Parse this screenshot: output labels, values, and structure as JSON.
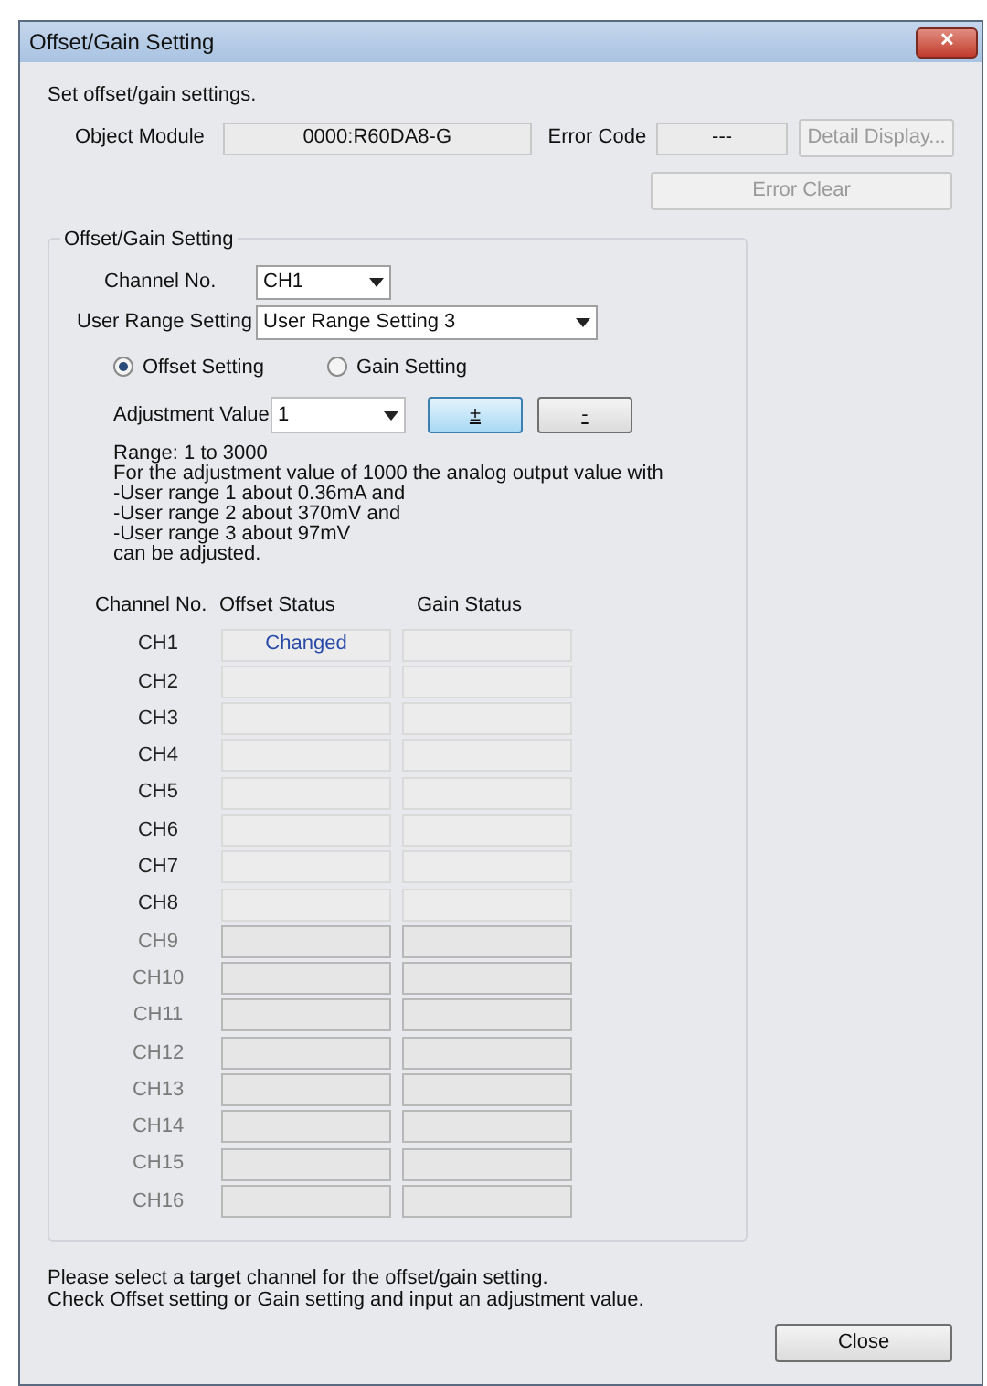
{
  "window": {
    "title": "Offset/Gain Setting",
    "close": "✕"
  },
  "intro": "Set offset/gain settings.",
  "module": {
    "label": "Object Module",
    "value": "0000:R60DA8-G"
  },
  "error": {
    "label": "Error Code",
    "value": "---",
    "detail_button": {
      "label": "Detail Display...",
      "disabled": true
    },
    "clear_button": {
      "label": "Error Clear",
      "disabled": true
    }
  },
  "group": {
    "title": "Offset/Gain Setting",
    "channel": {
      "label": "Channel No.",
      "value": "CH1"
    },
    "user_range": {
      "label": "User Range Setting",
      "value": "User Range Setting 3"
    },
    "radios": [
      {
        "label": "Offset Setting",
        "selected": true
      },
      {
        "label": "Gain Setting",
        "selected": false
      }
    ],
    "adjustment": {
      "label": "Adjustment Value",
      "value": "1",
      "plus_button": "±",
      "minus_button": "-"
    },
    "help": [
      "Range: 1 to 3000",
      "For the adjustment value of 1000 the analog output value with",
      "-User range 1 about 0.36mA and",
      "-User range 2 about 370mV and",
      "-User range 3 about 97mV",
      "can be adjusted."
    ],
    "table": {
      "columns": [
        "Channel No.",
        "Offset Status",
        "Gain Status"
      ],
      "rows": [
        {
          "channel": "CH1",
          "offset": "Changed",
          "enabled": true
        },
        {
          "channel": "CH2",
          "enabled": true
        },
        {
          "channel": "CH3",
          "enabled": true
        },
        {
          "channel": "CH4",
          "enabled": true
        },
        {
          "channel": "CH5",
          "enabled": true
        },
        {
          "channel": "CH6",
          "enabled": true
        },
        {
          "channel": "CH7",
          "enabled": true
        },
        {
          "channel": "CH8",
          "enabled": true
        },
        {
          "channel": "CH9",
          "enabled": false
        },
        {
          "channel": "CH10",
          "enabled": false
        },
        {
          "channel": "CH11",
          "enabled": false
        },
        {
          "channel": "CH12",
          "enabled": false
        },
        {
          "channel": "CH13",
          "enabled": false
        },
        {
          "channel": "CH14",
          "enabled": false
        },
        {
          "channel": "CH15",
          "enabled": false
        },
        {
          "channel": "CH16",
          "enabled": false
        }
      ]
    }
  },
  "footer": [
    "Please select a target channel for the offset/gain setting.",
    "Check Offset setting or Gain setting and input an adjustment value."
  ],
  "close_button": "Close"
}
